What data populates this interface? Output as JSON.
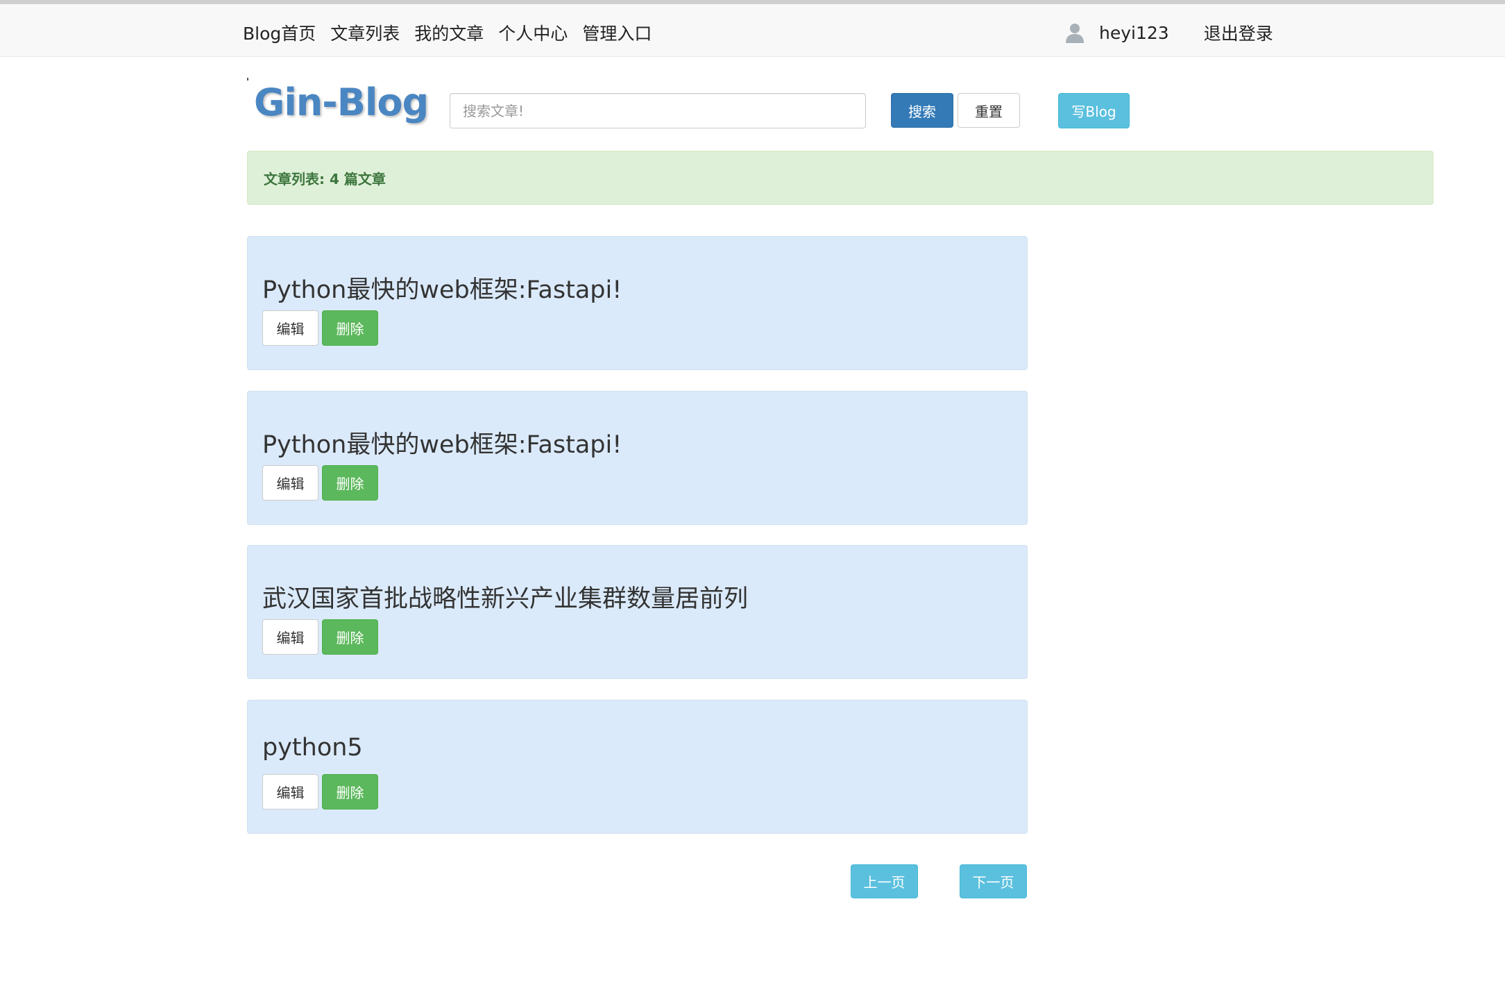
{
  "nav": {
    "links": [
      "Blog首页",
      "文章列表",
      "我的文章",
      "个人中心",
      "管理入口"
    ],
    "username": "heyi123",
    "logout": "退出登录"
  },
  "header": {
    "logo": "Gin-Blog",
    "search_placeholder": "搜索文章!",
    "search_button": "搜索",
    "reset_button": "重置",
    "write_button": "写Blog"
  },
  "alert": {
    "text": "文章列表: 4 篇文章"
  },
  "articles": [
    {
      "title": "Python最快的web框架:Fastapi!",
      "edit": "编辑",
      "delete": "删除"
    },
    {
      "title": "Python最快的web框架:Fastapi!",
      "edit": "编辑",
      "delete": "删除"
    },
    {
      "title": "武汉国家首批战略性新兴产业集群数量居前列",
      "edit": "编辑",
      "delete": "删除"
    },
    {
      "title": "python5",
      "edit": "编辑",
      "delete": "删除"
    }
  ],
  "pagination": {
    "prev": "上一页",
    "next": "下一页"
  },
  "colors": {
    "primary": "#337ab7",
    "info": "#5bc0de",
    "success": "#5cb85c",
    "alert_bg": "#dff0d8",
    "alert_text": "#3c763d",
    "card_bg": "#dbeafa",
    "logo": "#4a86c2"
  }
}
